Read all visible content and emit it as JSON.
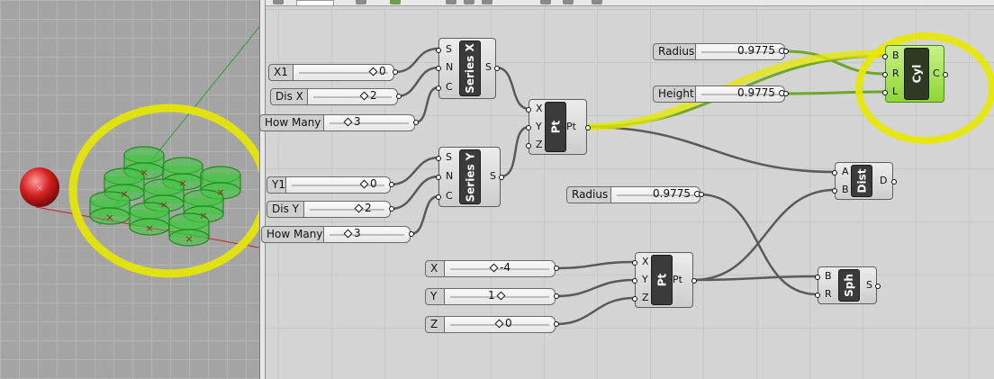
{
  "viewport": {
    "name": "Rhino perspective viewport"
  },
  "sliders": [
    {
      "id": "x1",
      "label": "X1",
      "value": "0"
    },
    {
      "id": "disx",
      "label": "Dis X",
      "value": "2"
    },
    {
      "id": "howmanyx",
      "label": "How Many X",
      "value": "3"
    },
    {
      "id": "y1",
      "label": "Y1",
      "value": "0"
    },
    {
      "id": "disy",
      "label": "Dis Y",
      "value": "2"
    },
    {
      "id": "howmanyy",
      "label": "How Manyy",
      "value": "3"
    },
    {
      "id": "radius1",
      "label": "Radius",
      "value": "0.9775"
    },
    {
      "id": "height",
      "label": "Height",
      "value": "0.9775"
    },
    {
      "id": "radius2",
      "label": "Radius",
      "value": "0.9775"
    },
    {
      "id": "x",
      "label": "X",
      "value": "-4"
    },
    {
      "id": "y",
      "label": "Y",
      "value": "1"
    },
    {
      "id": "z",
      "label": "Z",
      "value": "0"
    }
  ],
  "components": {
    "series_x": {
      "name": "Series X",
      "inputs": [
        "S",
        "N",
        "C"
      ],
      "output": "S"
    },
    "series_y": {
      "name": "Series Y",
      "inputs": [
        "S",
        "N",
        "C"
      ],
      "output": "S"
    },
    "pt1": {
      "name": "Pt",
      "inputs": [
        "X",
        "Y",
        "Z"
      ],
      "output": "Pt"
    },
    "cyl": {
      "name": "Cyl",
      "inputs": [
        "B",
        "R",
        "L"
      ],
      "output": "C"
    },
    "dist": {
      "name": "Dist",
      "inputs": [
        "A",
        "B"
      ],
      "output": "D"
    },
    "pt2": {
      "name": "Pt",
      "inputs": [
        "X",
        "Y",
        "Z"
      ],
      "output": "Pt"
    },
    "sph": {
      "name": "Sph",
      "inputs": [
        "B",
        "R"
      ],
      "output": "S"
    }
  },
  "colors": {
    "selected": "#8fd636",
    "highlight": "#e8e800",
    "cylinders": "#2fbf2f",
    "sphere": "#d42020"
  }
}
